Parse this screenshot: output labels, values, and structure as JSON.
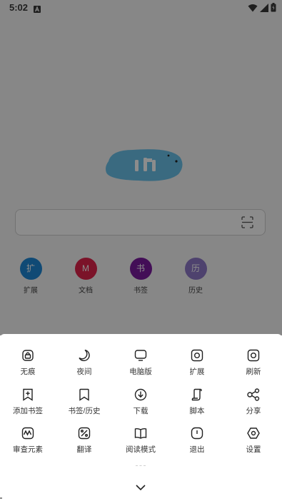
{
  "status_bar": {
    "time": "5:02",
    "app_icon": "a-notification-icon",
    "icons": [
      "wifi-icon",
      "signal-icon",
      "battery-icon"
    ]
  },
  "home": {
    "logo": "browser-logo",
    "search": {
      "placeholder": "",
      "scan_icon": "scan-icon"
    },
    "shortcuts": [
      {
        "glyph": "扩",
        "label": "扩展",
        "color": "#1e88d6"
      },
      {
        "glyph": "M",
        "label": "文档",
        "color": "#e0244c"
      },
      {
        "glyph": "书",
        "label": "书签",
        "color": "#7a1a9e"
      },
      {
        "glyph": "历",
        "label": "历史",
        "color": "#8f78c8"
      }
    ]
  },
  "menu": {
    "items": [
      {
        "label": "无痕",
        "icon": "incognito-lock-icon"
      },
      {
        "label": "夜间",
        "icon": "moon-icon"
      },
      {
        "label": "电脑版",
        "icon": "desktop-icon"
      },
      {
        "label": "扩展",
        "icon": "extension-icon"
      },
      {
        "label": "刷新",
        "icon": "refresh-icon"
      },
      {
        "label": "添加书签",
        "icon": "add-bookmark-icon"
      },
      {
        "label": "书签/历史",
        "icon": "bookmark-icon"
      },
      {
        "label": "下载",
        "icon": "download-icon"
      },
      {
        "label": "脚本",
        "icon": "script-icon"
      },
      {
        "label": "分享",
        "icon": "share-icon"
      },
      {
        "label": "审查元素",
        "icon": "inspect-icon"
      },
      {
        "label": "翻译",
        "icon": "translate-icon"
      },
      {
        "label": "阅读模式",
        "icon": "book-icon"
      },
      {
        "label": "退出",
        "icon": "power-icon"
      },
      {
        "label": "设置",
        "icon": "settings-icon"
      }
    ],
    "collapse_icon": "chevron-down-icon"
  }
}
